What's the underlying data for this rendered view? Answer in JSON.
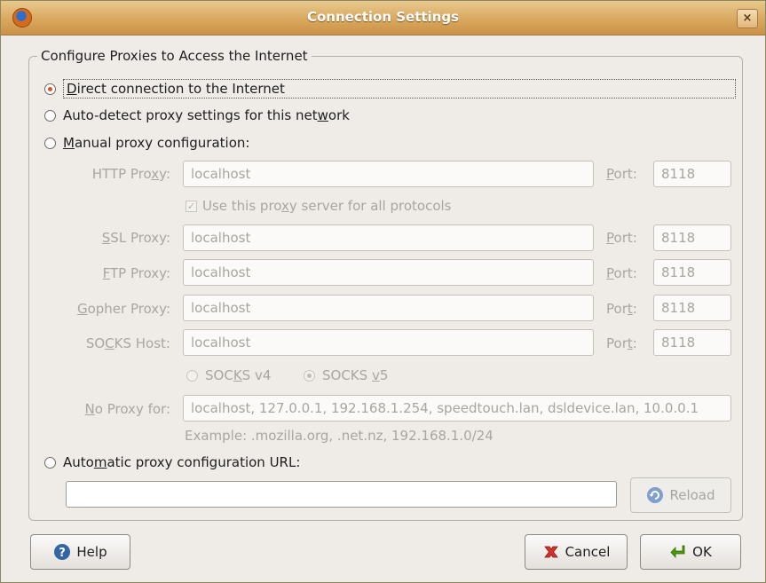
{
  "window": {
    "title": "Connection Settings",
    "close_glyph": "×"
  },
  "group": {
    "legend": "Configure Proxies to Access the Internet"
  },
  "options": {
    "direct": {
      "pre": "",
      "key": "D",
      "post": "irect connection to the Internet",
      "selected": true
    },
    "autodetect": {
      "pre": "Auto-detect proxy settings for this net",
      "key": "w",
      "post": "ork",
      "selected": false
    },
    "manual": {
      "pre": "",
      "key": "M",
      "post": "anual proxy configuration:",
      "selected": false
    },
    "auto_url": {
      "pre": "Auto",
      "key": "m",
      "post": "atic proxy configuration URL:",
      "selected": false
    }
  },
  "proxies": {
    "http": {
      "label_pre": "HTTP Pro",
      "label_key": "x",
      "label_post": "y:",
      "value": "localhost",
      "port": "8118"
    },
    "ssl": {
      "label_pre": "",
      "label_key": "S",
      "label_post": "SL Proxy:",
      "value": "localhost",
      "port": "8118"
    },
    "ftp": {
      "label_pre": "",
      "label_key": "F",
      "label_post": "TP Proxy:",
      "value": "localhost",
      "port": "8118"
    },
    "gopher": {
      "label_pre": "",
      "label_key": "G",
      "label_post": "opher Proxy:",
      "value": "localhost",
      "port": "8118"
    },
    "socks": {
      "label_pre": "SO",
      "label_key": "C",
      "label_post": "KS Host:",
      "value": "localhost",
      "port": "8118"
    }
  },
  "port_labels": {
    "http": {
      "pre": "",
      "key": "P",
      "post": "ort:"
    },
    "ssl": {
      "pre": "",
      "key": "P",
      "post": "ort:"
    },
    "ftp": {
      "pre": "",
      "key": "P",
      "post": "ort:"
    },
    "gopher": {
      "pre": "Por",
      "key": "t",
      "post": ":"
    },
    "socks": {
      "pre": "Por",
      "key": "t",
      "post": ":"
    }
  },
  "share": {
    "pre": "Use this pro",
    "key": "x",
    "post": "y server for all protocols",
    "checked": true
  },
  "socks_versions": {
    "v4": {
      "pre": "SOC",
      "key": "K",
      "post": "S v4",
      "selected": false
    },
    "v5": {
      "pre": "SOCKS ",
      "key": "v",
      "post": "5",
      "selected": true
    }
  },
  "no_proxy": {
    "label_pre": "",
    "label_key": "N",
    "label_post": "o Proxy for:",
    "value": "localhost, 127.0.0.1, 192.168.1.254, speedtouch.lan, dsldevice.lan, 10.0.0.1",
    "example": "Example: .mozilla.org, .net.nz, 192.168.1.0/24"
  },
  "auto_url_field": {
    "value": ""
  },
  "buttons": {
    "reload": "Reload",
    "help": "Help",
    "cancel": "Cancel",
    "ok": "OK"
  },
  "icons": {
    "app": "firefox-icon",
    "reload": "reload-icon",
    "help": "help-icon",
    "cancel": "cancel-icon",
    "ok": "ok-arrow-icon"
  },
  "colors": {
    "titlebar": "#d9a85e",
    "radio_selected": "#d2562a",
    "disabled_text": "#a9a5a0"
  }
}
